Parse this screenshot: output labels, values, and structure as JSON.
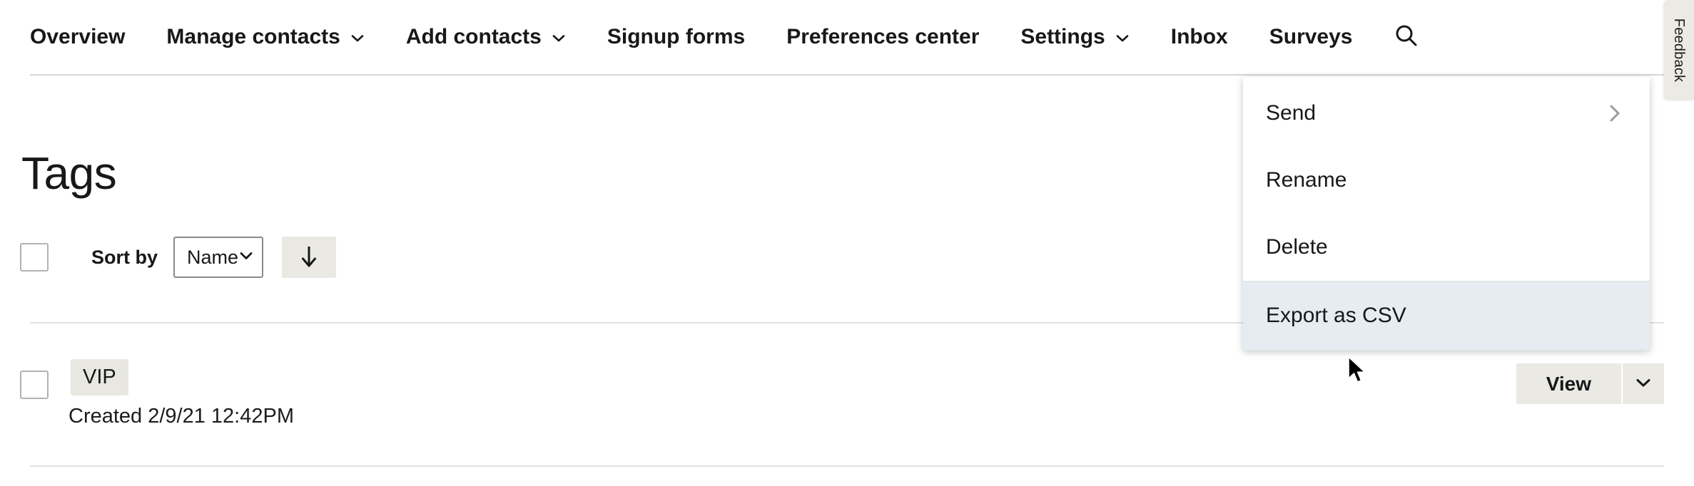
{
  "nav": {
    "items": [
      {
        "label": "Overview",
        "has_caret": false
      },
      {
        "label": "Manage contacts",
        "has_caret": true
      },
      {
        "label": "Add contacts",
        "has_caret": true
      },
      {
        "label": "Signup forms",
        "has_caret": false
      },
      {
        "label": "Preferences center",
        "has_caret": false
      },
      {
        "label": "Settings",
        "has_caret": true
      },
      {
        "label": "Inbox",
        "has_caret": false
      },
      {
        "label": "Surveys",
        "has_caret": false
      }
    ],
    "search_icon": "search-icon"
  },
  "feedback": {
    "label": "Feedback"
  },
  "page": {
    "title": "Tags"
  },
  "toolbar": {
    "select_all_checkbox": "",
    "sort_by_label": "Sort by",
    "sort_field_value": "Name",
    "sort_field_options": [
      "Name"
    ],
    "sort_direction_icon": "arrow-down-icon"
  },
  "tags": [
    {
      "name": "VIP",
      "created": "Created 2/9/21 12:42PM",
      "view_label": "View",
      "view_caret_icon": "chevron-down-icon"
    }
  ],
  "dropdown": {
    "items": [
      {
        "label": "Send",
        "submenu_icon": "chevron-right-icon",
        "highlighted": false
      },
      {
        "label": "Rename",
        "submenu_icon": "",
        "highlighted": false
      },
      {
        "label": "Delete",
        "submenu_icon": "",
        "highlighted": false
      },
      {
        "label": "Export as CSV",
        "submenu_icon": "",
        "highlighted": true
      }
    ]
  },
  "colors": {
    "page_background": "#ffffff",
    "text_primary": "#16181a",
    "button_beige": "#eae9e3",
    "chip_beige": "#e8e7e0",
    "menu_highlight": "#e6ecf1",
    "menu_highlight_border": "#dfe9e5",
    "divider": "#e2e1dd",
    "nav_border": "#d6d6d2"
  }
}
